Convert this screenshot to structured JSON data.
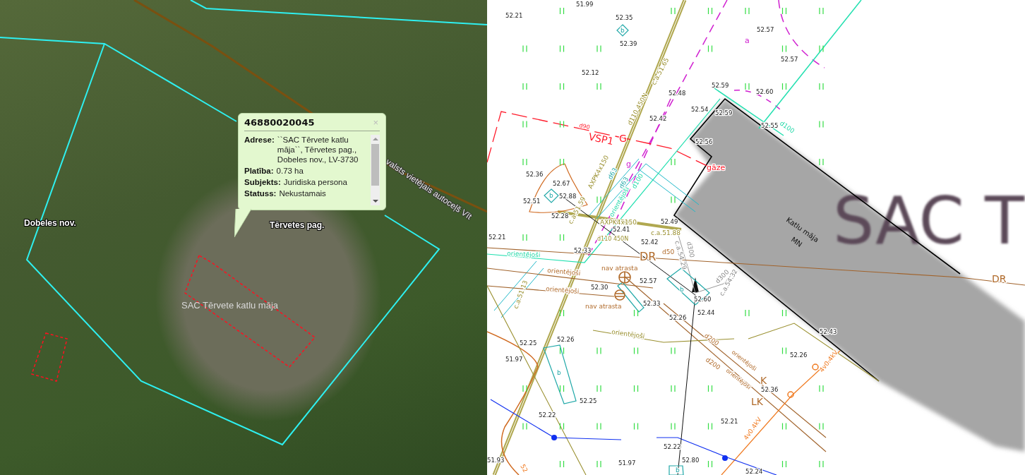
{
  "aerial": {
    "labels": [
      {
        "text": "Dobeles nov.",
        "kind": "region"
      },
      {
        "text": "Tērvetes pag.",
        "kind": "region"
      },
      {
        "text": "SAC Tērvete  katlu māja",
        "kind": "building"
      },
      {
        "text": "valsts vietējais autoceļš Vīt",
        "kind": "road"
      }
    ]
  },
  "popup": {
    "title": "46880020045",
    "close": "×",
    "fields": [
      {
        "label": "Adrese:",
        "value": "``SAC Tērvete katlu māja``, Tērvetes pag., Dobeles nov., LV-3730"
      },
      {
        "label": "Platība:",
        "value": "0.73 ha"
      },
      {
        "label": "Subjekts:",
        "value": "Juridiska persona"
      },
      {
        "label": "Statuss:",
        "value": "Nekustamais"
      }
    ]
  },
  "survey_map": {
    "building": {
      "name": "Katlu māja",
      "code": "MN"
    },
    "overlay_label": "SAC T",
    "labels": [
      {
        "text": "51.99",
        "kind": "elevation"
      },
      {
        "text": "52.21",
        "kind": "elevation"
      },
      {
        "text": "52.35",
        "kind": "elevation"
      },
      {
        "text": "52.39",
        "kind": "elevation"
      },
      {
        "text": "52.12",
        "kind": "elevation"
      },
      {
        "text": "52.48",
        "kind": "elevation"
      },
      {
        "text": "52.59",
        "kind": "elevation"
      },
      {
        "text": "52.54",
        "kind": "elevation"
      },
      {
        "text": "52.42",
        "kind": "elevation"
      },
      {
        "text": "52.59",
        "kind": "elevation"
      },
      {
        "text": "52.56",
        "kind": "elevation"
      },
      {
        "text": "52.57",
        "kind": "elevation"
      },
      {
        "text": "52.57",
        "kind": "elevation"
      },
      {
        "text": "52.60",
        "kind": "elevation"
      },
      {
        "text": "52.55",
        "kind": "elevation"
      },
      {
        "text": "52.36",
        "kind": "elevation"
      },
      {
        "text": "52.67",
        "kind": "elevation"
      },
      {
        "text": "52.88",
        "kind": "elevation"
      },
      {
        "text": "52.51",
        "kind": "elevation"
      },
      {
        "text": "52.28",
        "kind": "elevation"
      },
      {
        "text": "52.41",
        "kind": "elevation"
      },
      {
        "text": "52.21",
        "kind": "elevation"
      },
      {
        "text": "52.49",
        "kind": "elevation"
      },
      {
        "text": "52.42",
        "kind": "elevation"
      },
      {
        "text": "52.33",
        "kind": "elevation"
      },
      {
        "text": "52.30",
        "kind": "elevation"
      },
      {
        "text": "52.57",
        "kind": "elevation"
      },
      {
        "text": "52.33",
        "kind": "elevation"
      },
      {
        "text": "52.60",
        "kind": "elevation"
      },
      {
        "text": "52.44",
        "kind": "elevation"
      },
      {
        "text": "52.26",
        "kind": "elevation"
      },
      {
        "text": "52.43",
        "kind": "elevation"
      },
      {
        "text": "52.26",
        "kind": "elevation"
      },
      {
        "text": "52.36",
        "kind": "elevation"
      },
      {
        "text": "52.25",
        "kind": "elevation"
      },
      {
        "text": "52.26",
        "kind": "elevation"
      },
      {
        "text": "51.97",
        "kind": "elevation"
      },
      {
        "text": "52.25",
        "kind": "elevation"
      },
      {
        "text": "52.22",
        "kind": "elevation"
      },
      {
        "text": "52.21",
        "kind": "elevation"
      },
      {
        "text": "52.22",
        "kind": "elevation"
      },
      {
        "text": "51.93",
        "kind": "elevation"
      },
      {
        "text": "51.97",
        "kind": "elevation"
      },
      {
        "text": "52.80",
        "kind": "elevation"
      },
      {
        "text": "52.24",
        "kind": "elevation"
      },
      {
        "text": "orientējoši",
        "kind": "aqua"
      },
      {
        "text": "orientējoši",
        "kind": "brown"
      },
      {
        "text": "orientējoši",
        "kind": "brown"
      },
      {
        "text": "nav atrasta",
        "kind": "brown"
      },
      {
        "text": "nav atrasta",
        "kind": "brown"
      },
      {
        "text": "DR",
        "kind": "brown"
      },
      {
        "text": "d50",
        "kind": "brown"
      },
      {
        "text": "DR",
        "kind": "brown"
      },
      {
        "text": "orientējoši",
        "kind": "olive"
      },
      {
        "text": "d200",
        "kind": "brown"
      },
      {
        "text": "d200",
        "kind": "brown"
      },
      {
        "text": "orientējoši",
        "kind": "brown"
      },
      {
        "text": "orientējoši",
        "kind": "brown"
      },
      {
        "text": "K",
        "kind": "brown"
      },
      {
        "text": "LK",
        "kind": "brown"
      },
      {
        "text": "4v0.4kV",
        "kind": "orange"
      },
      {
        "text": "4v0.4kV",
        "kind": "orange"
      },
      {
        "text": "52",
        "kind": "orange"
      },
      {
        "text": "c.a.51.65",
        "kind": "olive"
      },
      {
        "text": "d110 450N",
        "kind": "olive"
      },
      {
        "text": "AXPK4x150",
        "kind": "olive"
      },
      {
        "text": "c.a.51.59",
        "kind": "olive"
      },
      {
        "text": "AXPK4x150",
        "kind": "olive"
      },
      {
        "text": "d110 450N",
        "kind": "olive"
      },
      {
        "text": "c.a.51.88",
        "kind": "olive"
      },
      {
        "text": "c.a.51.13",
        "kind": "olive"
      },
      {
        "text": "c.a.54.29",
        "kind": "grey"
      },
      {
        "text": "d300",
        "kind": "grey"
      },
      {
        "text": "d300",
        "kind": "grey"
      },
      {
        "text": "c.a.54.32",
        "kind": "grey"
      },
      {
        "text": "d63",
        "kind": "cyan"
      },
      {
        "text": "d63",
        "kind": "cyan"
      },
      {
        "text": "d100",
        "kind": "aqua"
      },
      {
        "text": "orientējoši",
        "kind": "aqua"
      },
      {
        "text": "d100",
        "kind": "aqua"
      },
      {
        "text": "d90",
        "kind": "red"
      },
      {
        "text": "VSP1",
        "kind": "red"
      },
      {
        "text": "G",
        "kind": "red"
      },
      {
        "text": "gāze",
        "kind": "red"
      },
      {
        "text": "a",
        "kind": "magenta"
      },
      {
        "text": "g",
        "kind": "magenta"
      },
      {
        "text": "b",
        "kind": "cyan"
      },
      {
        "text": "b",
        "kind": "cyan"
      },
      {
        "text": "b",
        "kind": "cyan"
      },
      {
        "text": "b",
        "kind": "cyan"
      },
      {
        "text": "b",
        "kind": "cyan"
      }
    ]
  }
}
